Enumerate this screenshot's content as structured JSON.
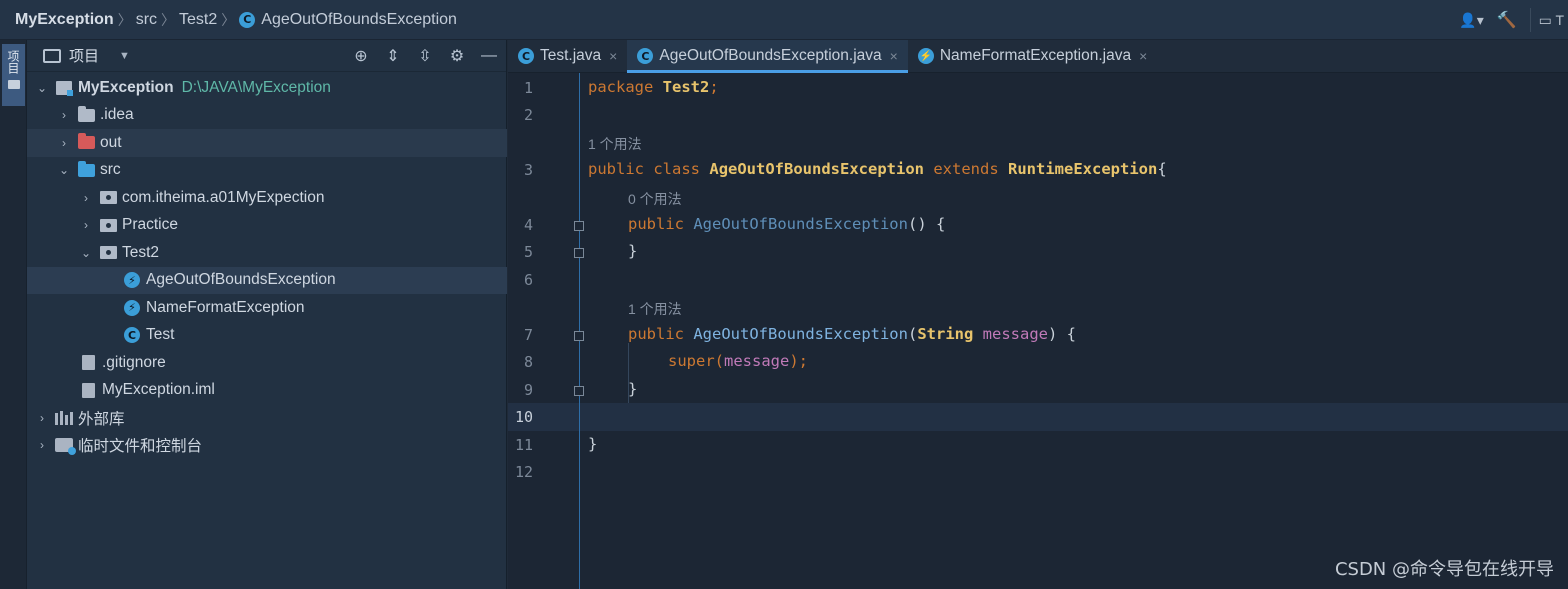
{
  "breadcrumb": {
    "project": "MyException",
    "items": [
      "src",
      "Test2"
    ],
    "current": "AgeOutOfBoundsException",
    "current_badge": "C"
  },
  "topbar_right": {
    "run_label": "T"
  },
  "toolstrip": {
    "project_tab": "项目"
  },
  "project_panel": {
    "title": "项目",
    "tree": [
      {
        "label": "MyException",
        "path": "D:\\JAVA\\MyException"
      },
      {
        "label": ".idea"
      },
      {
        "label": "out"
      },
      {
        "label": "src"
      },
      {
        "label": "com.itheima.a01MyExpection"
      },
      {
        "label": "Practice"
      },
      {
        "label": "Test2"
      },
      {
        "label": "AgeOutOfBoundsException"
      },
      {
        "label": "NameFormatException"
      },
      {
        "label": "Test"
      },
      {
        "label": ".gitignore"
      },
      {
        "label": "MyException.iml"
      },
      {
        "label": "外部库"
      },
      {
        "label": "临时文件和控制台"
      }
    ]
  },
  "tabs": [
    {
      "label": "Test.java",
      "badge": "C"
    },
    {
      "label": "AgeOutOfBoundsException.java",
      "badge": "C"
    },
    {
      "label": "NameFormatException.java",
      "badge": "⚡"
    }
  ],
  "code": {
    "line_numbers": [
      "1",
      "2",
      "3",
      "4",
      "5",
      "6",
      "7",
      "8",
      "9",
      "10",
      "11",
      "12"
    ],
    "hints": [
      "1 个用法",
      "0 个用法",
      "1 个用法"
    ],
    "l1_kw": "package",
    "l1_name": "Test2",
    "l1_end": ";",
    "l3_kw1": "public",
    "l3_kw2": "class",
    "l3_cls": "AgeOutOfBoundsException",
    "l3_kw3": "extends",
    "l3_super": "RuntimeException",
    "l3_brace": "{",
    "l4_kw": "public",
    "l4_ctor": "AgeOutOfBoundsException",
    "l4_rest": "() {",
    "l5": "}",
    "l7_kw": "public",
    "l7_ctor": "AgeOutOfBoundsException",
    "l7_open": "(",
    "l7_type": "String",
    "l7_param": "message",
    "l7_rest": ") {",
    "l8_super": "super",
    "l8_open": "(",
    "l8_arg": "message",
    "l8_end": ");",
    "l9": "}",
    "l11": "}"
  },
  "watermark": "CSDN @命令导包在线开导"
}
